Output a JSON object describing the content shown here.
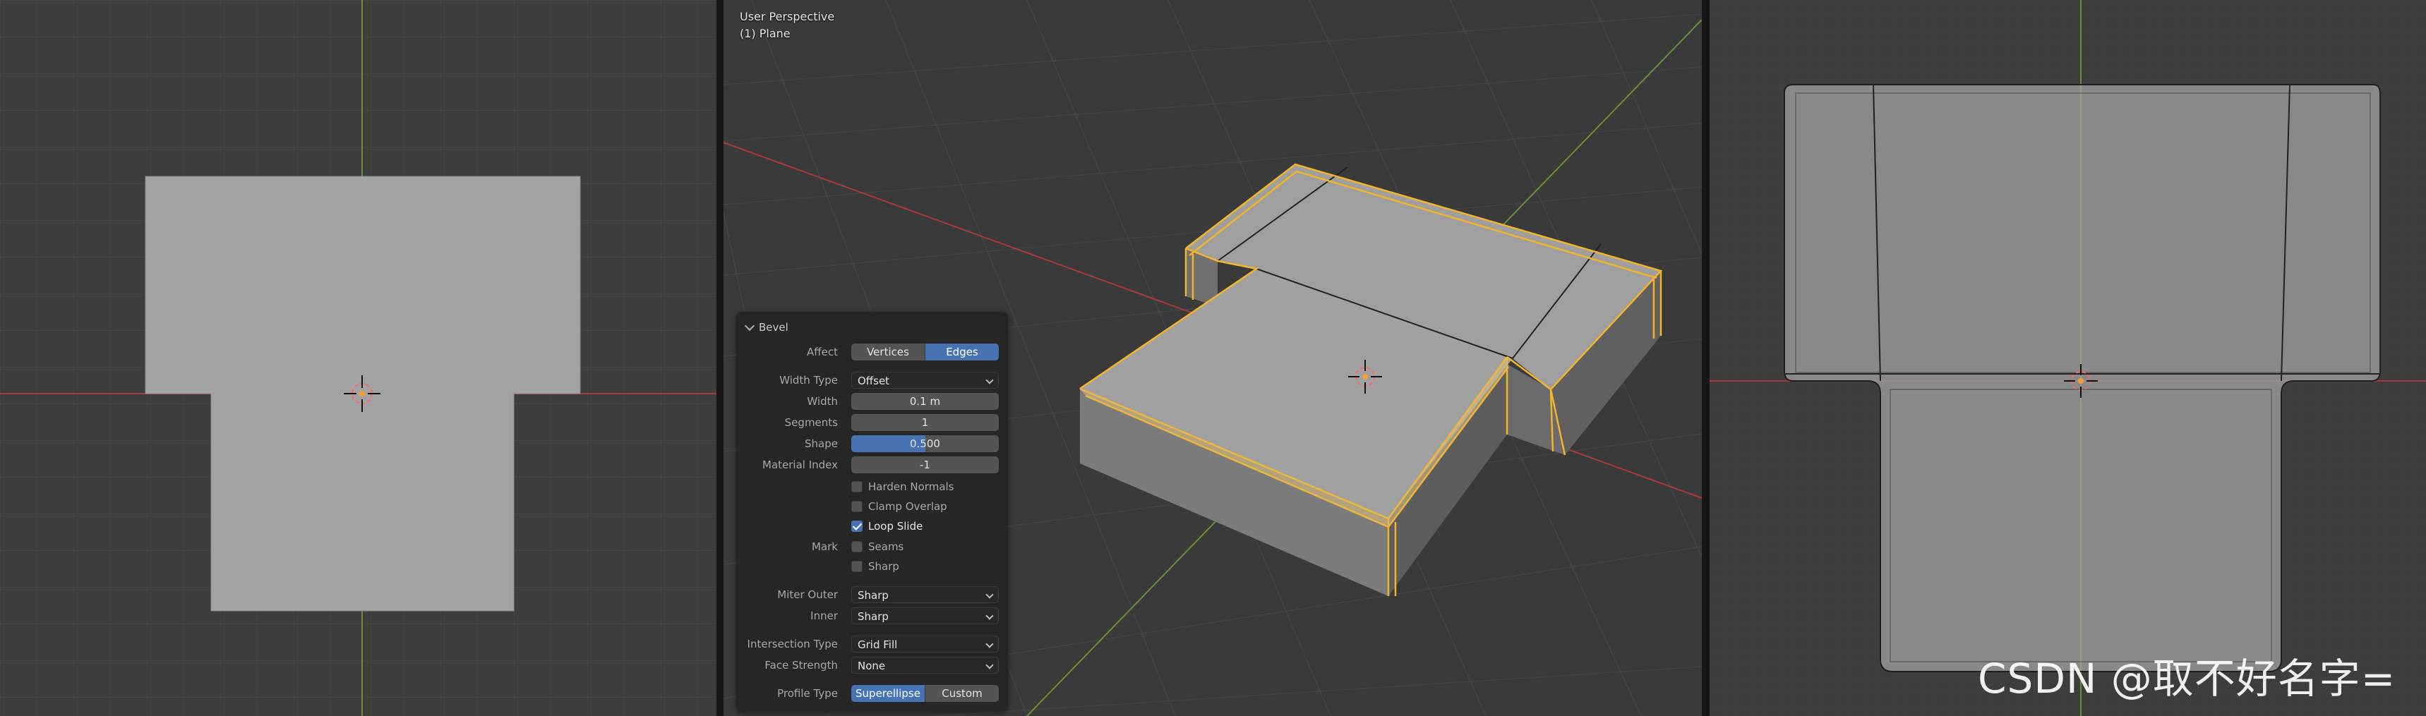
{
  "viewport_center": {
    "mode": "User Perspective",
    "object": "(1) Plane"
  },
  "bevel_panel": {
    "title": "Bevel",
    "affect": {
      "label": "Affect",
      "options": [
        "Vertices",
        "Edges"
      ],
      "selected": "Edges"
    },
    "width_type": {
      "label": "Width Type",
      "value": "Offset"
    },
    "width": {
      "label": "Width",
      "value": "0.1 m"
    },
    "segments": {
      "label": "Segments",
      "value": "1"
    },
    "shape": {
      "label": "Shape",
      "value": "0.500",
      "fraction": 0.5
    },
    "material_index": {
      "label": "Material Index",
      "value": "-1"
    },
    "harden_normals": {
      "label": "Harden Normals",
      "checked": false
    },
    "clamp_overlap": {
      "label": "Clamp Overlap",
      "checked": false
    },
    "loop_slide": {
      "label": "Loop Slide",
      "checked": true
    },
    "mark": {
      "label": "Mark",
      "seams": "Seams",
      "sharp": "Sharp",
      "seams_checked": false,
      "sharp_checked": false
    },
    "miter_outer": {
      "label": "Miter Outer",
      "value": "Sharp"
    },
    "inner": {
      "label": "Inner",
      "value": "Sharp"
    },
    "intersection_type": {
      "label": "Intersection Type",
      "value": "Grid Fill"
    },
    "face_strength": {
      "label": "Face Strength",
      "value": "None"
    },
    "profile_type": {
      "label": "Profile Type",
      "options": [
        "Superellipse",
        "Custom"
      ],
      "selected": "Superellipse"
    }
  },
  "watermark": "CSDN @取不好名字=",
  "colors": {
    "viewport_bg": "#3d3d3d",
    "grid": "#484848",
    "x_axis": "#b23a3a",
    "y_axis": "#6b8f2e",
    "mesh_face": "#a5a5a5",
    "selected_edge": "#f2b42a",
    "accent": "#4772b3"
  }
}
